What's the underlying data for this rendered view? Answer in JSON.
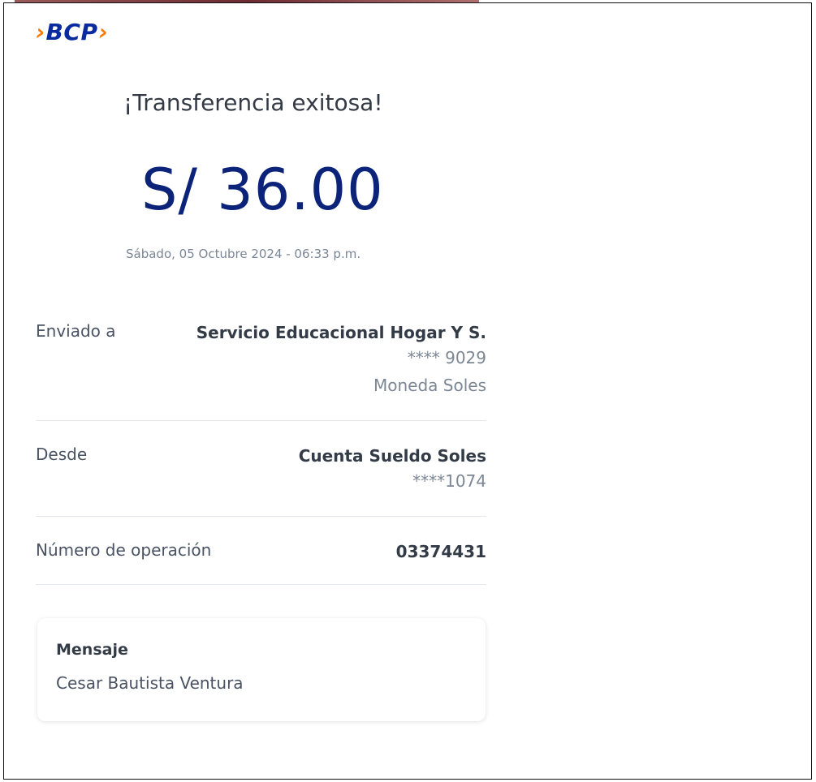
{
  "brand": {
    "logo_text": "BCP",
    "chevron_left": "›",
    "chevron_right": "›",
    "logo_color": "#0a2aa0",
    "accent_color": "#ff7800"
  },
  "receipt": {
    "title": "¡Transferencia exitosa!",
    "amount": "S/ 36.00",
    "datetime": "Sábado, 05 Octubre 2024 - 06:33 p.m.",
    "amount_color": "#0b2379"
  },
  "details": {
    "sent_to": {
      "label": "Enviado a",
      "name": "Servicio Educacional Hogar Y S.",
      "account": "**** 9029",
      "currency": "Moneda Soles"
    },
    "from": {
      "label": "Desde",
      "account_name": "Cuenta Sueldo Soles",
      "account": "****1074"
    },
    "operation": {
      "label": "Número de operación",
      "value": "03374431"
    }
  },
  "message": {
    "title": "Mensaje",
    "text": "Cesar Bautista Ventura"
  }
}
